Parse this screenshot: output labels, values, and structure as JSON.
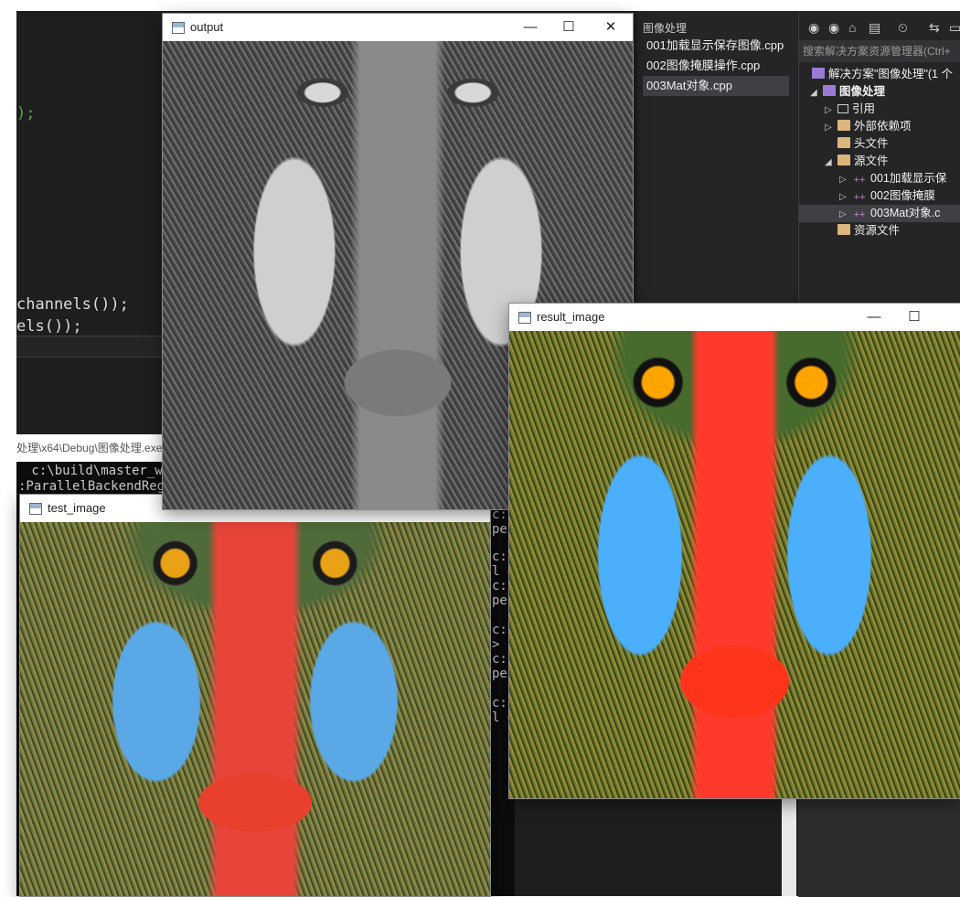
{
  "editor": {
    "lines": [
      {
        "text": ");",
        "green": true
      },
      {
        "text": "channels());",
        "green": false
      },
      {
        "text": "els());",
        "green": false
      }
    ]
  },
  "path_bar": "处理\\x64\\Debug\\图像处理.exe",
  "console": {
    "lines": [
      " c:\\build\\master_win",
      ":ParallelBackendRegi",
      "c:\\u",
      "pen",
      "c:\\u",
      "l =",
      "c:\\u",
      "pen",
      "c:\\u",
      "> F",
      "c:\\u",
      "pen",
      "c:\\u",
      "l ="
    ]
  },
  "tab_panel": {
    "title": "图像处理",
    "items": [
      "001加载显示保存图像.cpp",
      "002图像掩膜操作.cpp",
      "003Mat对象.cpp"
    ]
  },
  "solution_explorer": {
    "search_placeholder": "搜索解决方案资源管理器(Ctrl+",
    "toolbar_icons": [
      "back-icon",
      "forward-icon",
      "home-icon",
      "sync-icon",
      "history-icon",
      "switch-icon"
    ],
    "tree": {
      "solution": "解决方案\"图像处理\"(1 个",
      "project": "图像处理",
      "references": "引用",
      "external_deps": "外部依赖项",
      "headers": "头文件",
      "sources": "源文件",
      "file1": "001加载显示保",
      "file2": "002图像掩膜",
      "file3": "003Mat对象.c",
      "resources": "资源文件"
    }
  },
  "windows": {
    "output": {
      "title": "output",
      "minimize": "—",
      "maximize": "☐",
      "close": "✕"
    },
    "result_image": {
      "title": "result_image",
      "minimize": "—",
      "maximize": "☐"
    },
    "test_image": {
      "title": "test_image"
    }
  },
  "colors": {
    "ide_bg": "#1e1e1e",
    "panel_bg": "#252526",
    "selection": "#3f3f46",
    "code_green": "#57a64a"
  }
}
